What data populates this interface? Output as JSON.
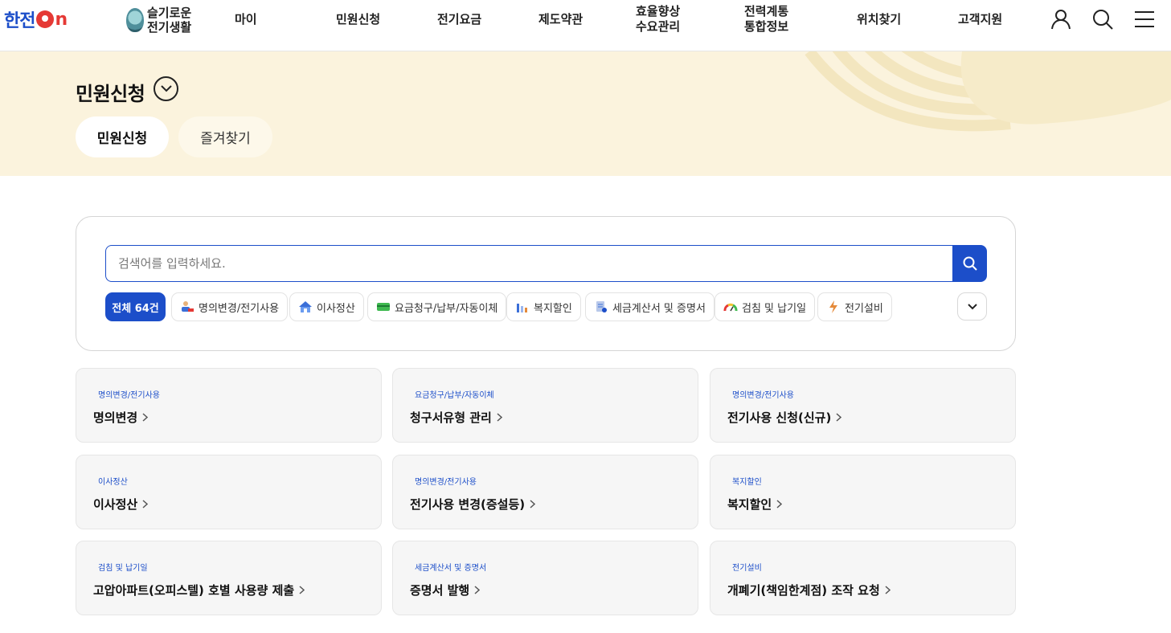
{
  "header": {
    "logo_text": "한전",
    "logo_on_suffix": "n",
    "smart_life": {
      "line1": "슬기로운",
      "line2": "전기생활"
    },
    "nav": [
      {
        "label": "마이"
      },
      {
        "label": "민원신청"
      },
      {
        "label": "전기요금"
      },
      {
        "label": "제도약관"
      },
      {
        "line1": "효율향상",
        "line2": "수요관리"
      },
      {
        "line1": "전력계통",
        "line2": "통합정보"
      },
      {
        "label": "위치찾기"
      },
      {
        "label": "고객지원"
      }
    ],
    "icons": [
      "user-icon",
      "search-icon",
      "menu-icon"
    ]
  },
  "banner": {
    "title": "민원신청",
    "tabs": [
      {
        "label": "민원신청",
        "active": true
      },
      {
        "label": "즐겨찾기",
        "active": false
      }
    ]
  },
  "search": {
    "placeholder": "검색어를 입력하세요.",
    "filters": [
      {
        "label": "전체 64건",
        "active": true
      },
      {
        "label": "명의변경/전기사용",
        "icon": "worker-icon"
      },
      {
        "label": "이사정산",
        "icon": "house-icon"
      },
      {
        "label": "요금청구/납부/자동이체",
        "icon": "card-icon"
      },
      {
        "label": "복지할인",
        "icon": "chart-icon"
      },
      {
        "label": "세금계산서 및 증명서",
        "icon": "document-icon"
      },
      {
        "label": "검침 및 납기일",
        "icon": "gauge-icon"
      },
      {
        "label": "전기설비",
        "icon": "lightning-icon"
      }
    ]
  },
  "cards": [
    {
      "category": "명의변경/전기사용",
      "title": "명의변경"
    },
    {
      "category": "요금청구/납부/자동이체",
      "title": "청구서유형 관리"
    },
    {
      "category": "명의변경/전기사용",
      "title": "전기사용 신청(신규)"
    },
    {
      "category": "이사정산",
      "title": "이사정산"
    },
    {
      "category": "명의변경/전기사용",
      "title": "전기사용 변경(증설등)"
    },
    {
      "category": "복지할인",
      "title": "복지할인"
    },
    {
      "category": "검침 및 납기일",
      "title": "고압아파트(오피스텔) 호별 사용량 제출"
    },
    {
      "category": "세금계산서 및 증명서",
      "title": "증명서 발행"
    },
    {
      "category": "전기설비",
      "title": "개폐기(책임한계점) 조작 요청"
    }
  ],
  "colors": {
    "brand_blue": "#1c4ec9",
    "brand_red": "#e53935",
    "banner_bg": "#fbf3dd",
    "card_bg": "#f6f6f6"
  }
}
